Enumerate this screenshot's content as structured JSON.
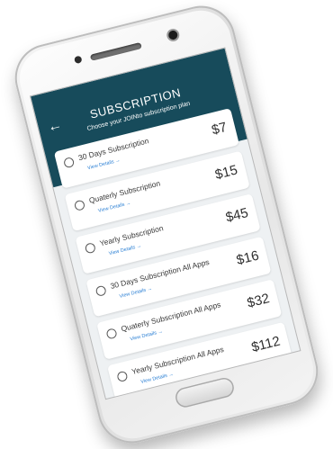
{
  "header": {
    "title": "SUBSCRIPTION",
    "subtitle": "Choose your JOINto subscription plan",
    "back_icon": "back-arrow-icon"
  },
  "colors": {
    "header_bg": "#174b5b",
    "link": "#2a7fd4"
  },
  "plans": [
    {
      "name": "30 Days Subscription",
      "details": "View Details →",
      "price": "$7"
    },
    {
      "name": "Quaterly Subscription",
      "details": "View Details →",
      "price": "$15"
    },
    {
      "name": "Yearly Subscription",
      "details": "View Details →",
      "price": "$45"
    },
    {
      "name": "30 Days Subscription All Apps",
      "details": "View Details →",
      "price": "$16"
    },
    {
      "name": "Quaterly Subscription All Apps",
      "details": "View Details →",
      "price": "$32"
    },
    {
      "name": "Yearly Subscription All Apps",
      "details": "View Details →",
      "price": "$112"
    }
  ]
}
